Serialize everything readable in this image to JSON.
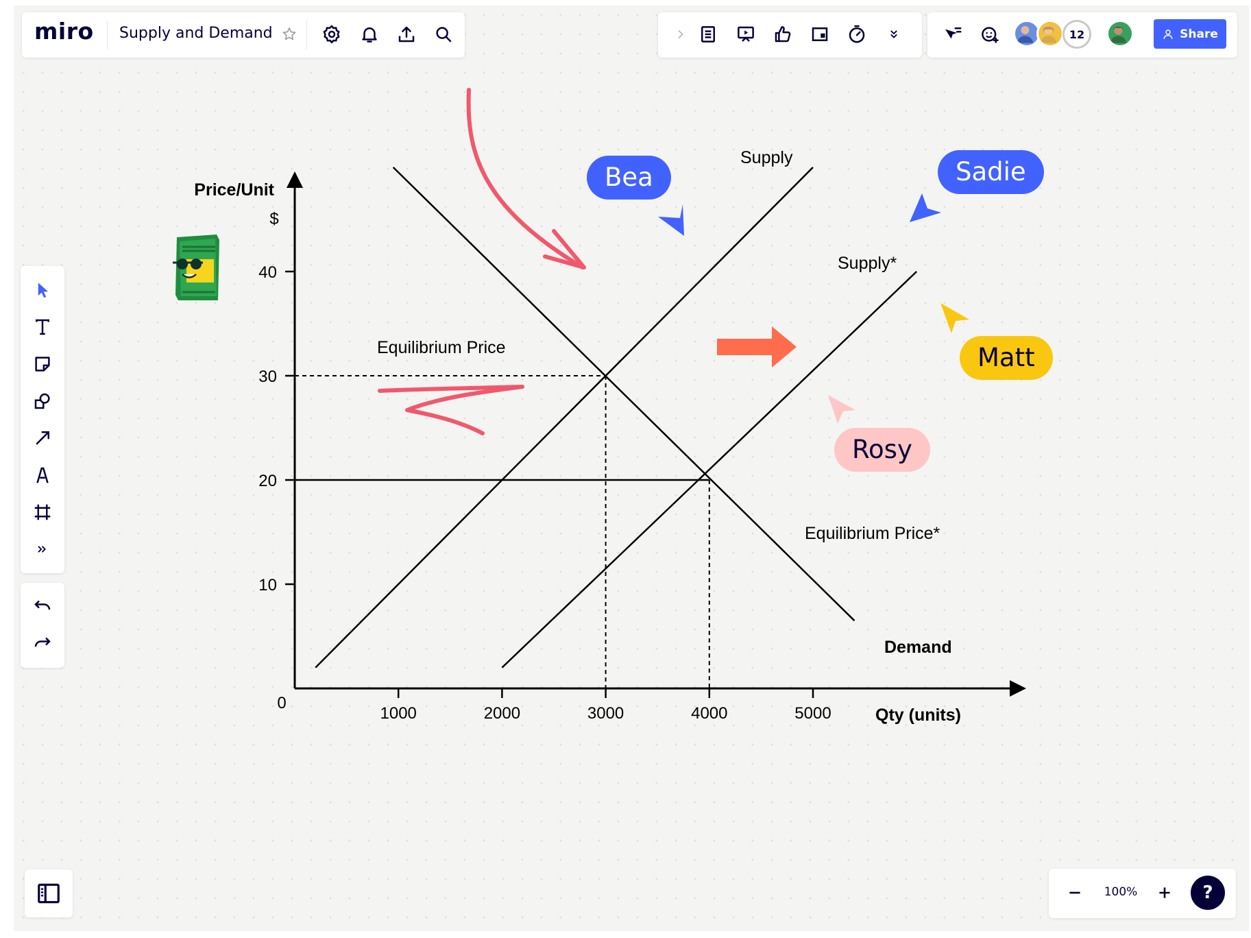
{
  "app": {
    "logo": "miro",
    "board_title": "Supply and Demand"
  },
  "top_left_toolbar": {
    "icons": [
      "star-icon",
      "settings-icon",
      "bell-icon",
      "upload-icon",
      "search-icon"
    ]
  },
  "top_center_toolbar": {
    "icons": [
      "chevron-right-icon",
      "notes-icon",
      "present-icon",
      "thumbs-up-icon",
      "card-icon",
      "timer-icon",
      "more-down-icon"
    ]
  },
  "collaboration": {
    "avatar_overflow_count": "12",
    "share_label": "Share"
  },
  "left_toolbar": {
    "tools": [
      "select-tool-icon",
      "text-tool-icon",
      "sticky-note-icon",
      "shapes-icon",
      "arrow-line-icon",
      "pen-icon",
      "frame-icon",
      "more-tools-icon"
    ],
    "history": [
      "undo-icon",
      "redo-icon"
    ]
  },
  "bottom_controls": {
    "zoom": "100%",
    "help": "?"
  },
  "cursors": [
    {
      "name": "Bea",
      "color": "#4262ff",
      "text_color": "#ffffff"
    },
    {
      "name": "Sadie",
      "color": "#4262ff",
      "text_color": "#ffffff"
    },
    {
      "name": "Matt",
      "color": "#fac710",
      "text_color": "#050038"
    },
    {
      "name": "Rosy",
      "color": "#ffc6c6",
      "text_color": "#050038"
    }
  ],
  "chart_data": {
    "type": "line",
    "ylabel": "Price/Unit",
    "ylabel_unit": "$",
    "xlabel": "Qty (units)",
    "origin_label": "0",
    "xlim": [
      0,
      6000
    ],
    "ylim": [
      0,
      40
    ],
    "x_ticks": [
      1000,
      2000,
      3000,
      4000,
      5000
    ],
    "y_ticks": [
      10,
      20,
      30,
      40
    ],
    "series": [
      {
        "name": "Demand",
        "points": [
          [
            950,
            50
          ],
          [
            5400,
            6.5
          ]
        ]
      },
      {
        "name": "Supply",
        "points": [
          [
            200,
            2
          ],
          [
            5000,
            50
          ]
        ]
      },
      {
        "name": "Supply*",
        "points": [
          [
            2000,
            2
          ],
          [
            6000,
            40
          ]
        ]
      },
      {
        "name": "",
        "points": [
          [
            0,
            20
          ],
          [
            4000,
            20
          ]
        ]
      }
    ],
    "annotations": [
      {
        "text": "Equilibrium Price",
        "x": 3000,
        "y": 30
      },
      {
        "text": "Equilibrium Price*",
        "x": 4000,
        "y": 20
      }
    ],
    "reference_lines": [
      {
        "from": [
          0,
          30
        ],
        "to": [
          3000,
          30
        ]
      },
      {
        "from": [
          3000,
          30
        ],
        "to": [
          3000,
          0
        ]
      },
      {
        "from": [
          4000,
          20
        ],
        "to": [
          4000,
          0
        ]
      }
    ],
    "grid": false,
    "colors": {
      "lines": "#000000",
      "pink_ink": "#f1586c",
      "arrow": "#ff6d4d"
    }
  }
}
